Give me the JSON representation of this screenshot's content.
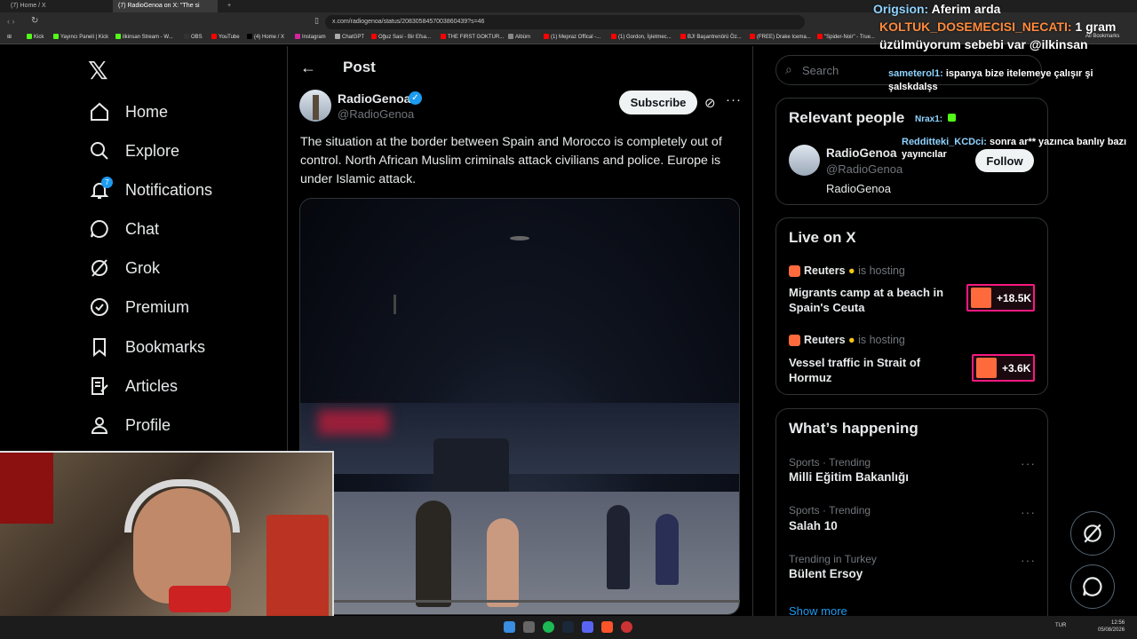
{
  "browser": {
    "tabs": [
      "(7) Home / X",
      "(7) RadioGenoa on X: \"The si"
    ],
    "url": "x.com/radiogenoa/status/2083058457003860439?s=46",
    "bookmarks": [
      "Kick",
      "Yayıncı Paneli | Kick",
      "ilkinsan Stream - W...",
      "OBS",
      "YouTube",
      "(4) Home / X",
      "Instagram",
      "ChatGPT",
      "Oğuz Sasi - Bir Efsa...",
      "THE FIRST GOKTUR...",
      "Albüm",
      "(1) Mepraz Offical -...",
      "(1) Gordon, İşletmec...",
      "BJ! Başantrenörü Öz...",
      "(FREE) Drake Icema...",
      "\"Spider-Noir\" - True..."
    ],
    "all_bookmarks": "All Bookmarks"
  },
  "nav": {
    "items": [
      {
        "label": "Home",
        "icon": "home-icon"
      },
      {
        "label": "Explore",
        "icon": "search-icon"
      },
      {
        "label": "Notifications",
        "icon": "bell-icon",
        "badge": "7"
      },
      {
        "label": "Chat",
        "icon": "chat-icon"
      },
      {
        "label": "Grok",
        "icon": "grok-icon"
      },
      {
        "label": "Premium",
        "icon": "premium-icon"
      },
      {
        "label": "Bookmarks",
        "icon": "bookmark-icon"
      },
      {
        "label": "Articles",
        "icon": "articles-icon"
      },
      {
        "label": "Profile",
        "icon": "profile-icon"
      }
    ]
  },
  "post": {
    "header": "Post",
    "author_name": "RadioGenoa",
    "author_handle": "@RadioGenoa",
    "subscribe_label": "Subscribe",
    "text": "The situation at the border between Spain and Morocco is completely out of control. North African Muslim criminals attack civilians and police. Europe is under Islamic attack.",
    "video_progress": 0.0
  },
  "sidebar": {
    "search_placeholder": "Search",
    "relevant": {
      "title": "Relevant people",
      "name": "RadioGenoa",
      "handle": "@RadioGenoa",
      "bio": "RadioGenoa",
      "follow_label": "Follow"
    },
    "live": {
      "title": "Live on X",
      "items": [
        {
          "host": "Reuters",
          "hosting": "is hosting",
          "title": "Migrants camp at a beach in Spain's Ceuta",
          "count": "+18.5K"
        },
        {
          "host": "Reuters",
          "hosting": "is hosting",
          "title": "Vessel traffic in Strait of Hormuz",
          "count": "+3.6K"
        }
      ]
    },
    "trends": {
      "title": "What’s happening",
      "items": [
        {
          "meta": "Sports · Trending",
          "name": "Milli Eğitim Bakanlığı"
        },
        {
          "meta": "Sports · Trending",
          "name": "Salah 10"
        },
        {
          "meta": "Trending in Turkey",
          "name": "Bülent Ersoy"
        }
      ],
      "show_more": "Show more"
    }
  },
  "chat_overlay": [
    {
      "user": "Origsion:",
      "msg": "Aferim arda"
    },
    {
      "user": "KOLTUK_DOSEMECISI_NECATI:",
      "msg": "1 gram üzülmüyorum sebebi var @ilkinsan"
    },
    {
      "user": "sameterol1:",
      "msg": "ispanya bize itelemeye çalışır şi şalskdalşs"
    },
    {
      "user": "Nrax1:",
      "msg": ""
    },
    {
      "user": "Redditteki_KCDci:",
      "msg": "sonra ar** yazınca banlıy bazı yayıncılar"
    }
  ],
  "taskbar": {
    "lang": "TUR",
    "time": "12:56",
    "date": "05/08/2026"
  },
  "colors": {
    "accent": "#1d9bf0",
    "live": "#f91880",
    "reuters": "#ff6a3d"
  }
}
